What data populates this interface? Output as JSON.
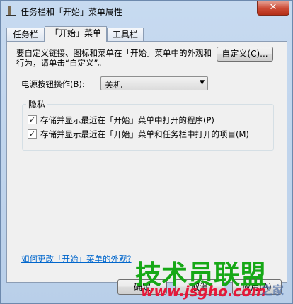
{
  "window": {
    "title": "任务栏和「开始」菜单属性",
    "close": "✕"
  },
  "tabs": [
    {
      "label": "任务栏"
    },
    {
      "label": "「开始」菜单"
    },
    {
      "label": "工具栏"
    }
  ],
  "start_menu": {
    "description": "要自定义链接、图标和菜单在「开始」菜单中的外观和行为，请单击“自定义”。",
    "customize_button": "自定义(C)...",
    "power_label": "电源按钮操作(B):",
    "power_value": "关机"
  },
  "privacy": {
    "title": "隐私",
    "items": [
      {
        "label": "存储并显示最近在「开始」菜单中打开的程序(P)",
        "checked": true
      },
      {
        "label": "存储并显示最近在「开始」菜单和任务栏中打开的项目(M)",
        "checked": true
      }
    ]
  },
  "help_link": "如何更改「开始」菜单的外观?",
  "footer": {
    "ok": "确定",
    "cancel": "取消",
    "apply": "应用(A)"
  },
  "watermark": {
    "main": "技术员联盟",
    "url": "www.jsgho.com",
    "suffix": "之家"
  }
}
